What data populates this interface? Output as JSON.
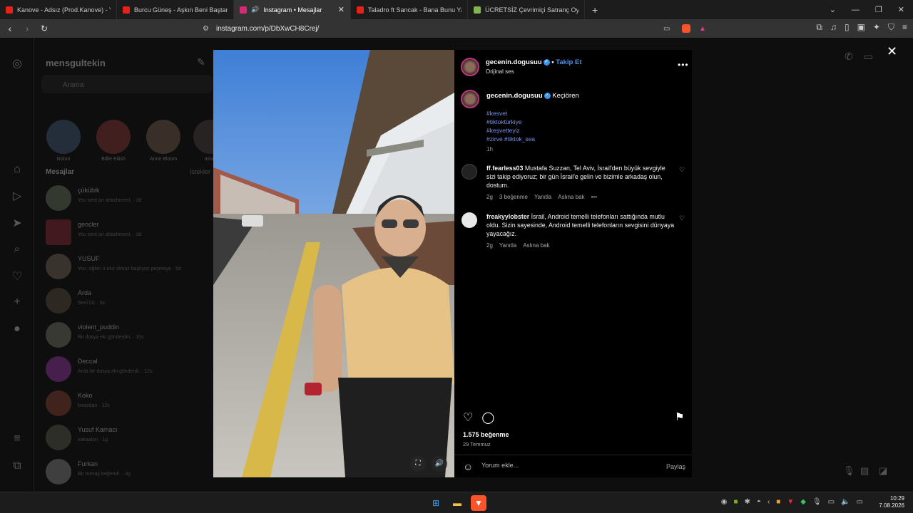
{
  "browser": {
    "tabs": [
      {
        "label": "Kanove - Adsız (Prod.Kanove) - YouTube",
        "fav_color": "#e62117"
      },
      {
        "label": "Burcu Güneş - Aşkın Beni Baştan Yaz",
        "fav_color": "#e62117"
      },
      {
        "label": "Instagram • Mesajlar",
        "fav_color": "#d62976"
      },
      {
        "label": "Taladro ft Sancak - Bana Bunu Yapma",
        "fav_color": "#e62117"
      },
      {
        "label": "ÜCRETSİZ Çevrimiçi Satranç Oynayın",
        "fav_color": "#81b64c"
      }
    ],
    "url": "instagram.com/p/DbXwCH8Crej/"
  },
  "dm_panel": {
    "username": "mensgultekin",
    "search_placeholder": "Arama",
    "stories": [
      {
        "top": "İçerik bir şey paylaş...",
        "name": "Notun"
      },
      {
        "top": "|| everything...",
        "name": "Billie Eilish"
      },
      {
        "top": "|| Love Me or...",
        "name": "Anne Bloom"
      },
      {
        "top": "|| Red B...",
        "name": "miraç"
      }
    ],
    "section_title": "Mesajlar",
    "requests": "İstekler",
    "conversations": [
      {
        "name": "çükübik",
        "sub": "You sent an attachment. · 3d"
      },
      {
        "name": "gencler",
        "sub": "You sent an attachment. · 3d"
      },
      {
        "name": "YUSUF",
        "sub": "You: öğlen 3 olur olmaz başlıyoz peşmeye · 5d"
      },
      {
        "name": "Arda",
        "sub": "Seni Dc · 6s"
      },
      {
        "name": "violent_puddin",
        "sub": "Bir dosya eki gönderdin. · 10s"
      },
      {
        "name": "Deccal",
        "sub": "Arda bir dosya eki gönderdi. · 12s"
      },
      {
        "name": "Koko",
        "sub": "bırazdan · 12s"
      },
      {
        "name": "Yusuf Kamacı",
        "sub": "vakaalon · 1g"
      },
      {
        "name": "Furkan",
        "sub": "Bir mesajı beğendi. · 3g"
      }
    ]
  },
  "post": {
    "author": "gecenin.dogusuu",
    "follow_label": "Takip Et",
    "audio": "Orijinal ses",
    "location": "Keçiören",
    "hashtags": [
      "#kesvet",
      "#tiktoktürkiye",
      "#keşvetteyiz",
      "#zirve #tiktok_sea"
    ],
    "caption_time": "1h",
    "comments": [
      {
        "user": "ff.fearless03",
        "text": "Mustafa Suzzan, Tel Aviv, İsrail'den büyük sevgiyle sizi takip ediyoruz; bir gün İsrail'e gelin ve bizimle arkadaş olun, dostum.",
        "time": "2g",
        "likes": "3 beğenme",
        "reply": "Yanıtla",
        "translate": "Aslına bak"
      },
      {
        "user": "freakyylobster",
        "text": "İsrail, Android temelli telefonları sattığında mutlu oldu. Sizin sayesinde, Android temelli telefonların sevgisini dünyaya yayacağız.",
        "time": "2g",
        "reply": "Yanıtla",
        "translate": "Aslına bak"
      }
    ],
    "likes_count": "1.575 beğenme",
    "date": "29 Temmuz",
    "comment_placeholder": "Yorum ekle...",
    "share_label": "Paylaş"
  },
  "system": {
    "time": "10:29",
    "date": "7.08.2026"
  }
}
